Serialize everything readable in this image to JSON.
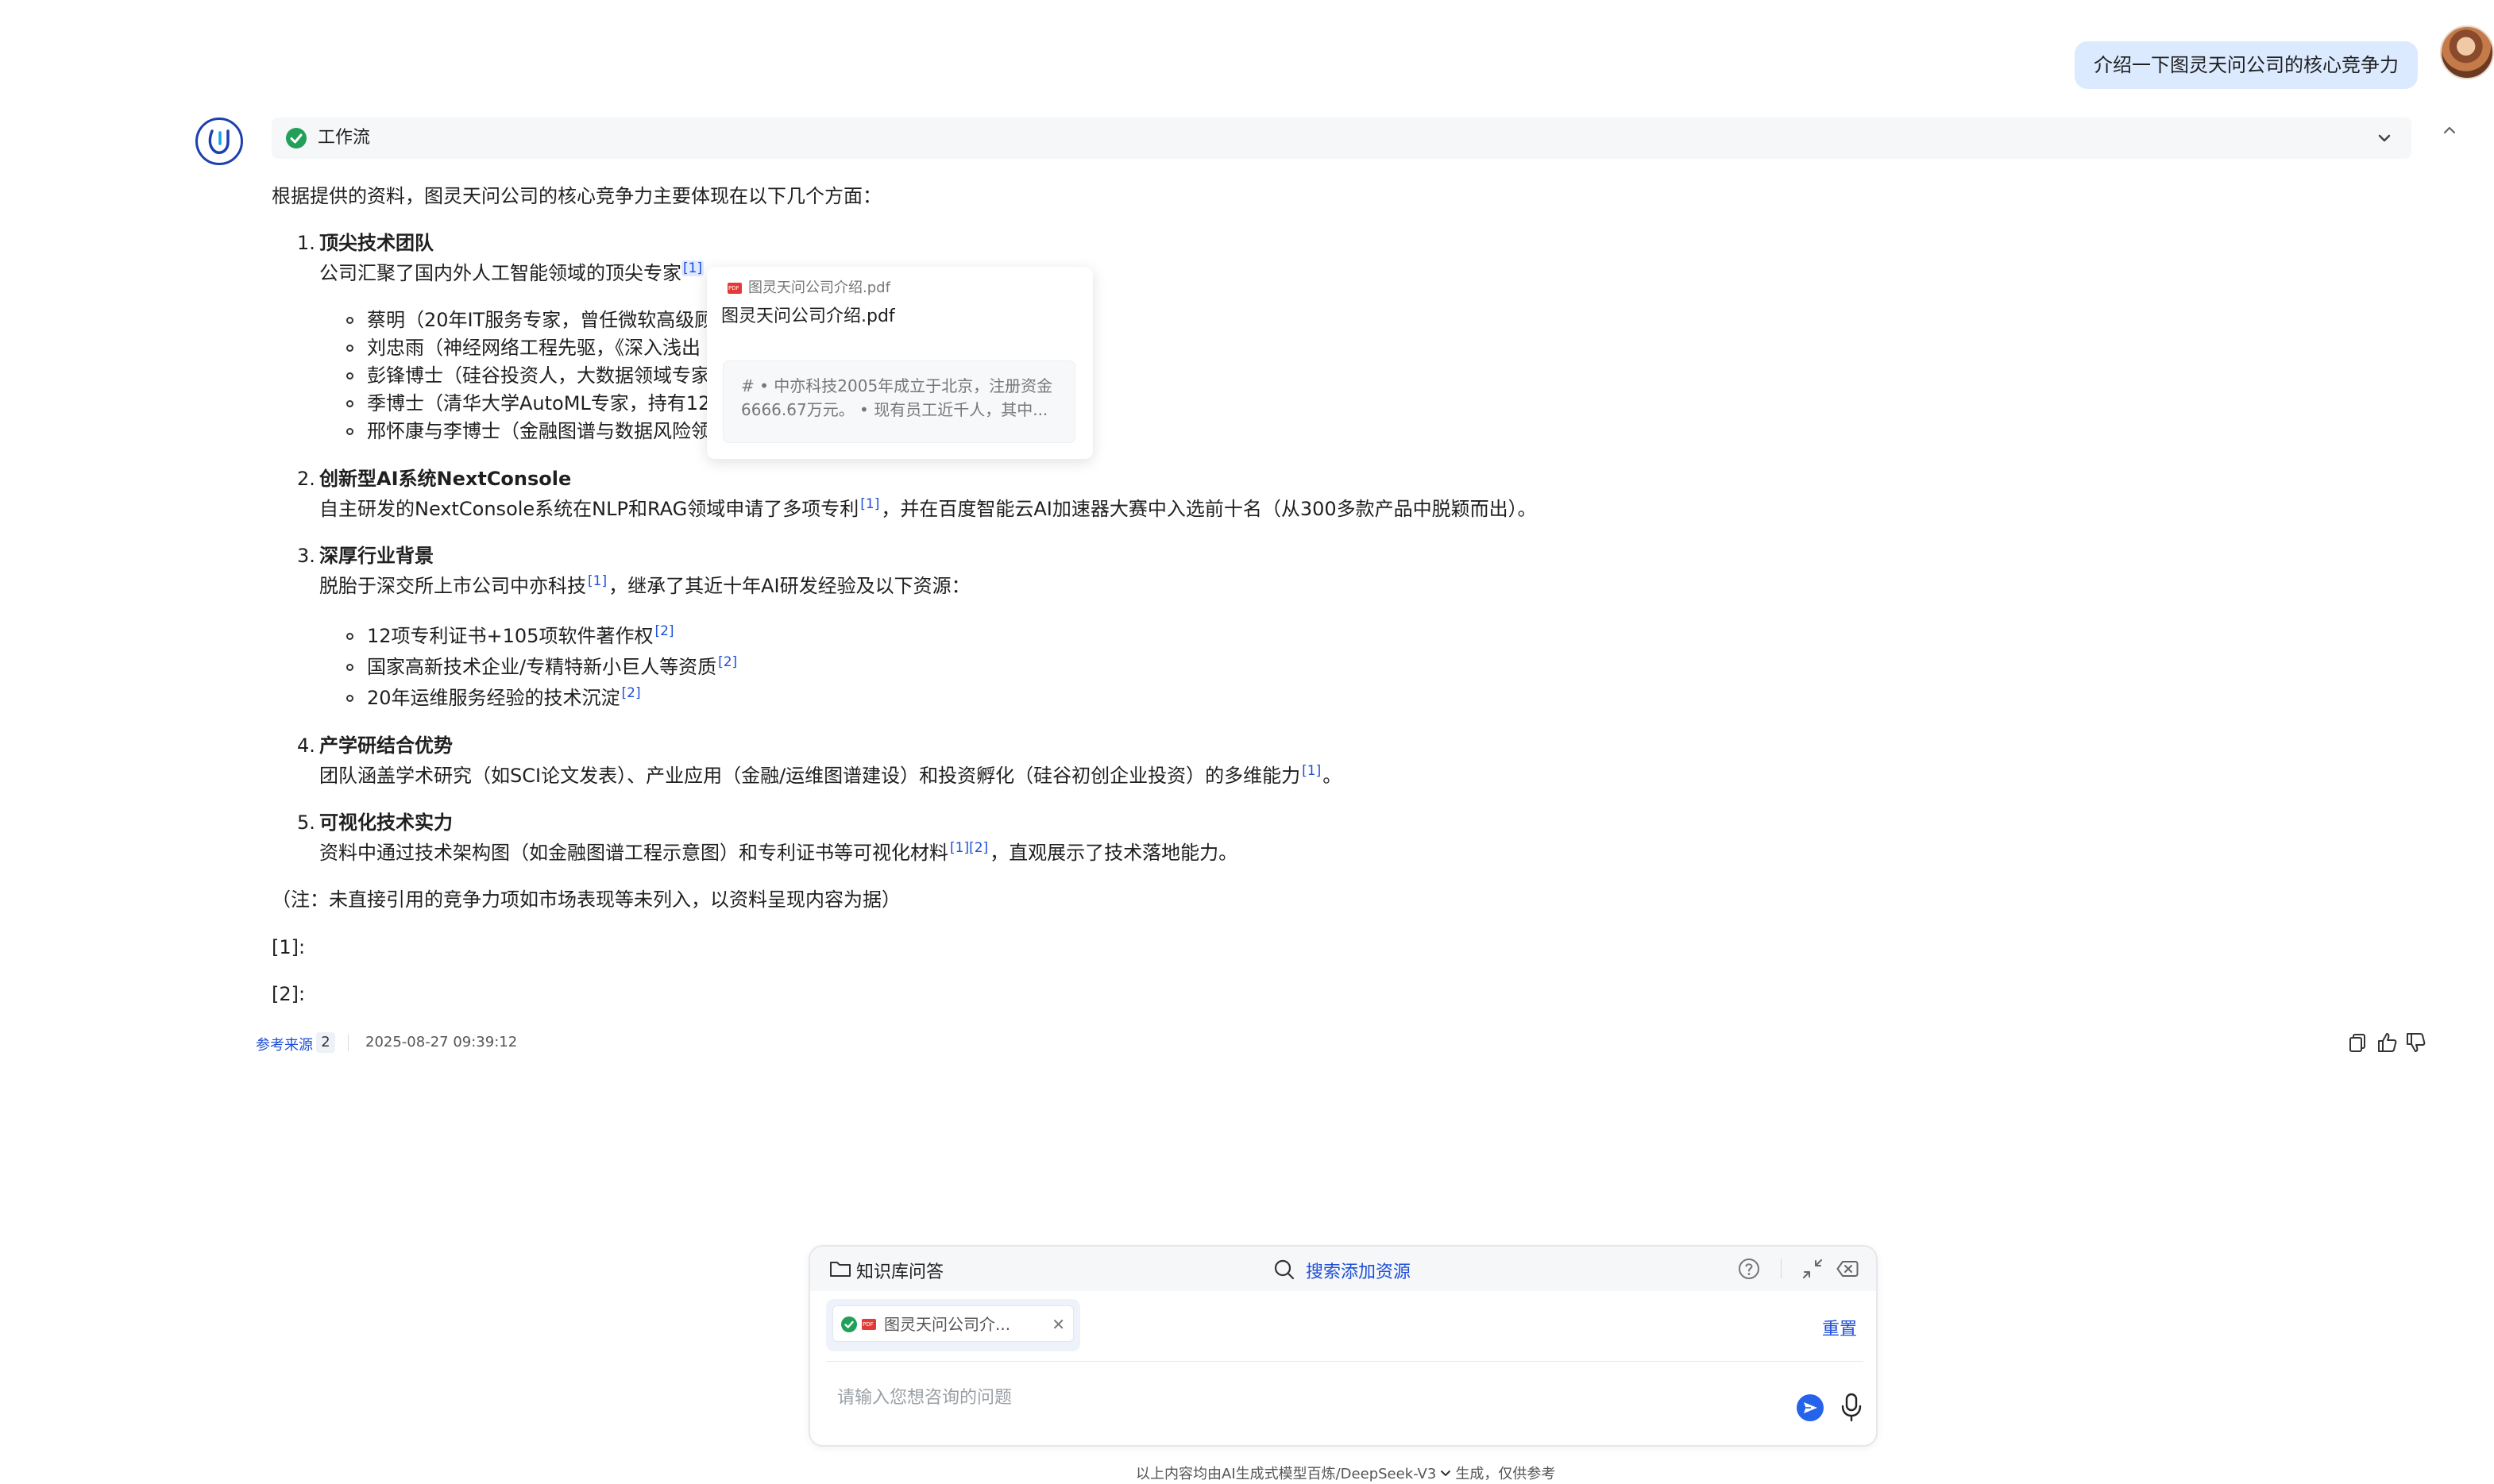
{
  "user_message": "介绍一下图灵天问公司的核心竞争力",
  "workflow": {
    "label": "工作流"
  },
  "answer": {
    "intro": "根据提供的资料，图灵天问公司的核心竞争力主要体现在以下几个方面：",
    "sections": [
      {
        "num": "1.",
        "title": "顶尖技术团队",
        "text": "公司汇聚了国内外人工智能领域的顶尖专家",
        "cite": "[1]",
        "bullets": [
          "蔡明（20年IT服务专家，曾任微软高级顾",
          "刘忠雨（神经网络工程先驱，《深入浅出",
          "彭锋博士（硅谷投资人，大数据领域专家",
          "季博士（清华大学AutoML专家，持有12",
          "邢怀康与李博士（金融图谱与数据风险领"
        ]
      },
      {
        "num": "2.",
        "title": "创新型AI系统NextConsole",
        "text_a": "自主研发的NextConsole系统在NLP和RAG领域申请了多项专利",
        "cite": "[1]",
        "text_b": "，并在百度智能云AI加速器大赛中入选前十名（从300多款产品中脱颖而出）。"
      },
      {
        "num": "3.",
        "title": "深厚行业背景",
        "text_a": "脱胎于深交所上市公司中亦科技",
        "cite": "[1]",
        "text_b": "，继承了其近十年AI研发经验及以下资源：",
        "bullets": [
          {
            "text": "12项专利证书+105项软件著作权",
            "cite": "[2]"
          },
          {
            "text": "国家高新技术企业/专精特新小巨人等资质",
            "cite": "[2]"
          },
          {
            "text": "20年运维服务经验的技术沉淀",
            "cite": "[2]"
          }
        ]
      },
      {
        "num": "4.",
        "title": "产学研结合优势",
        "text_a": "团队涵盖学术研究（如SCI论文发表）、产业应用（金融/运维图谱建设）和投资孵化（硅谷初创企业投资）的多维能力",
        "cite": "[1]",
        "text_b": "。"
      },
      {
        "num": "5.",
        "title": "可视化技术实力",
        "text_a": "资料中通过技术架构图（如金融图谱工程示意图）和专利证书等可视化材料",
        "cite": "[1][2]",
        "text_b": "，直观展示了技术落地能力。"
      }
    ],
    "note": "（注：未直接引用的竞争力项如市场表现等未列入，以资料呈现内容为据）",
    "refs": [
      "[1]:",
      "[2]:"
    ]
  },
  "popover": {
    "source": "图灵天问公司介绍.pdf",
    "title": "图灵天问公司介绍.pdf",
    "snippet": "# • 中亦科技2005年成立于北京，注册资金6666.67万元。 • 现有员工近千人，其中..."
  },
  "meta": {
    "sources_label": "参考来源",
    "sources_count": "2",
    "timestamp": "2025-08-27 09:39:12"
  },
  "input": {
    "kb_label": "知识库问答",
    "search_label": "搜索添加资源",
    "file_chip": "图灵天问公司介...",
    "reset_label": "重置",
    "placeholder": "请输入您想咨询的问题"
  },
  "footer": {
    "prefix": "以上内容均由AI生成式模型百炼/DeepSeek-V3",
    "suffix": "生成，仅供参考"
  },
  "colors": {
    "accent": "#1d4ed8",
    "success": "#22a05a",
    "user_bubble": "#dbeafe",
    "pdf": "#e53935"
  },
  "icons": [
    "check-circle-icon",
    "chevron-down-icon",
    "chevron-up-icon",
    "pdf-icon",
    "copy-icon",
    "thumbs-up-icon",
    "thumbs-down-icon",
    "folder-icon",
    "search-icon",
    "help-icon",
    "minimize-icon",
    "close-icon",
    "send-icon",
    "mic-icon"
  ]
}
